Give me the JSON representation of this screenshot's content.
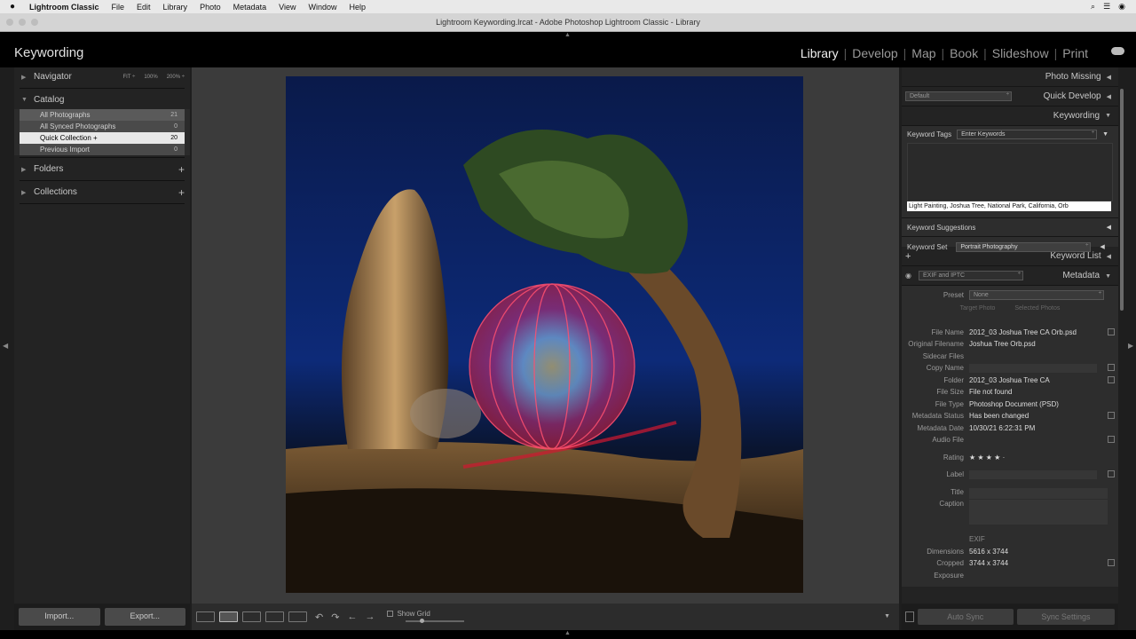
{
  "menubar": {
    "app_name": "Lightroom Classic",
    "items": [
      "File",
      "Edit",
      "Library",
      "Photo",
      "Metadata",
      "View",
      "Window",
      "Help"
    ]
  },
  "window": {
    "title": "Lightroom Keywording.lrcat - Adobe Photoshop Lightroom Classic - Library"
  },
  "header": {
    "identity": "Keywording",
    "modules": [
      "Library",
      "Develop",
      "Map",
      "Book",
      "Slideshow",
      "Print"
    ],
    "active_module": "Library"
  },
  "left_panel": {
    "navigator": {
      "label": "Navigator",
      "fit": "FIT ÷",
      "z1": "100%",
      "z2": "200% ÷"
    },
    "catalog": {
      "label": "Catalog",
      "items": [
        {
          "label": "All Photographs",
          "count": "21"
        },
        {
          "label": "All Synced Photographs",
          "count": "0"
        },
        {
          "label": "Quick Collection  +",
          "count": "20"
        },
        {
          "label": "Previous Import",
          "count": "0"
        }
      ]
    },
    "folders": {
      "label": "Folders"
    },
    "collections": {
      "label": "Collections"
    },
    "import_label": "Import...",
    "export_label": "Export..."
  },
  "toolbar": {
    "show_grid": "Show Grid"
  },
  "right_panel": {
    "photo_missing": "Photo Missing",
    "quick_develop": {
      "label": "Quick Develop",
      "preset": "Default"
    },
    "keywording": {
      "label": "Keywording",
      "tags_label": "Keyword Tags",
      "tags_mode": "Enter Keywords",
      "keywords": "Light Painting, Joshua Tree, National Park, California, Orb",
      "suggestions_label": "Keyword Suggestions",
      "set_label": "Keyword Set",
      "set_value": "Portrait Photography"
    },
    "keyword_list": "Keyword List",
    "metadata": {
      "label": "Metadata",
      "view": "EXIF and IPTC",
      "preset_label": "Preset",
      "preset_value": "None",
      "target_photo": "Target Photo",
      "selected_photos": "Selected Photos",
      "rows": [
        {
          "label": "File Name",
          "value": "2012_03 Joshua Tree CA Orb.psd"
        },
        {
          "label": "Original Filename",
          "value": "Joshua Tree Orb.psd"
        },
        {
          "label": "Sidecar Files",
          "value": ""
        },
        {
          "label": "Copy Name",
          "value": ""
        },
        {
          "label": "Folder",
          "value": "2012_03 Joshua Tree CA"
        },
        {
          "label": "File Size",
          "value": "File not found"
        },
        {
          "label": "File Type",
          "value": "Photoshop Document (PSD)"
        },
        {
          "label": "Metadata Status",
          "value": "Has been changed"
        },
        {
          "label": "Metadata Date",
          "value": "10/30/21 6:22:31 PM"
        },
        {
          "label": "Audio File",
          "value": ""
        }
      ],
      "rating_label": "Rating",
      "rating_stars": "★ ★ ★ ★  ·",
      "label_label": "Label",
      "title_label": "Title",
      "caption_label": "Caption",
      "exif_label": "EXIF",
      "dimensions_label": "Dimensions",
      "dimensions": "5616 x 3744",
      "cropped_label": "Cropped",
      "cropped": "3744 x 3744",
      "exposure_label": "Exposure"
    },
    "auto_sync": "Auto Sync",
    "sync_settings": "Sync Settings"
  }
}
